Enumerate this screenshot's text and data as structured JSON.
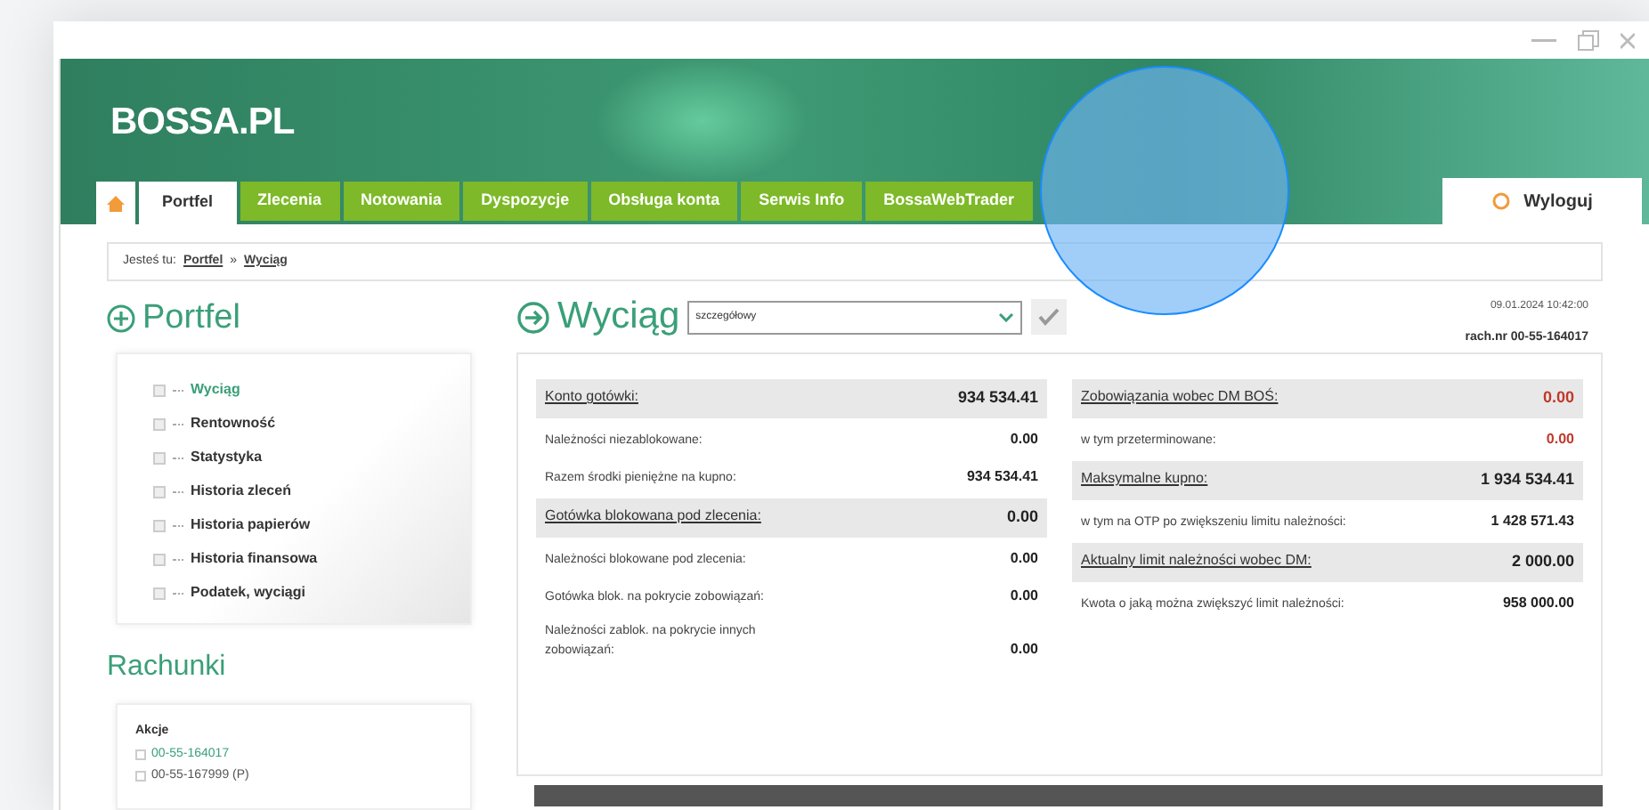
{
  "brand": {
    "logo": "BOSSA.PL"
  },
  "tabs": [
    {
      "label": "Portfel",
      "selected": true
    },
    {
      "label": "Zlecenia",
      "selected": false
    },
    {
      "label": "Notowania",
      "selected": false
    },
    {
      "label": "Dyspozycje",
      "selected": false
    },
    {
      "label": "Obsługa konta",
      "selected": false
    },
    {
      "label": "Serwis Info",
      "selected": false
    },
    {
      "label": "BossaWebTrader",
      "selected": false
    }
  ],
  "logout_button": "Wyloguj",
  "breadcrumb": {
    "prefix": "Jesteś tu:",
    "items": [
      "Portfel",
      "Wyciąg"
    ],
    "separator": "»"
  },
  "sidebar": {
    "title": "Portfel",
    "items": [
      {
        "label": "Wyciąg",
        "selected": true
      },
      {
        "label": "Rentowność",
        "selected": false
      },
      {
        "label": "Statystyka",
        "selected": false
      },
      {
        "label": "Historia zleceń",
        "selected": false
      },
      {
        "label": "Historia papierów",
        "selected": false
      },
      {
        "label": "Historia finansowa",
        "selected": false
      },
      {
        "label": "Podatek, wyciągi",
        "selected": false
      }
    ],
    "accounts_title": "Rachunki",
    "accounts_group": "Akcje",
    "accounts": [
      {
        "label": "00-55-164017",
        "selected": true
      },
      {
        "label": "00-55-167999 (P)",
        "selected": false
      }
    ]
  },
  "main": {
    "title": "Wyciąg",
    "view_select": "szczegółowy",
    "timestamp": "09.01.2024 10:42:00",
    "account": "rach.nr 00-55-164017",
    "columns": [
      [
        {
          "kind": "header",
          "label": "Konto gotówki:",
          "value": "934 534.41",
          "alert": false
        },
        {
          "kind": "item",
          "label": "Należności niezablokowane:",
          "value": "0.00",
          "alert": false
        },
        {
          "kind": "item",
          "label": "Razem środki pieniężne na kupno:",
          "value": "934 534.41",
          "alert": false
        },
        {
          "kind": "header",
          "label": "Gotówka blokowana pod zlecenia:",
          "value": "0.00",
          "alert": false
        },
        {
          "kind": "item",
          "label": "Należności blokowane pod zlecenia:",
          "value": "0.00",
          "alert": false
        },
        {
          "kind": "item",
          "label": "Gotówka blok. na pokrycie zobowiązań:",
          "value": "0.00",
          "alert": false
        },
        {
          "kind": "item",
          "label": "Należności zablok. na pokrycie innych zobowiązań:",
          "value": "0.00",
          "alert": false
        }
      ],
      [
        {
          "kind": "header",
          "label": "Zobowiązania wobec DM BOŚ:",
          "value": "0.00",
          "alert": true
        },
        {
          "kind": "item",
          "label": "w tym przeterminowane:",
          "value": "0.00",
          "alert": true
        },
        {
          "kind": "header",
          "label": "Maksymalne kupno:",
          "value": "1 934 534.41",
          "alert": false
        },
        {
          "kind": "item",
          "label": "w tym na OTP po zwiększeniu limitu należności:",
          "value": "1 428 571.43",
          "alert": false
        },
        {
          "kind": "header",
          "label": "Aktualny limit należności wobec DM:",
          "value": "2 000.00",
          "alert": false
        },
        {
          "kind": "item",
          "label": "Kwota o jaką można zwiększyć limit należności:",
          "value": "958 000.00",
          "alert": false
        }
      ]
    ]
  }
}
